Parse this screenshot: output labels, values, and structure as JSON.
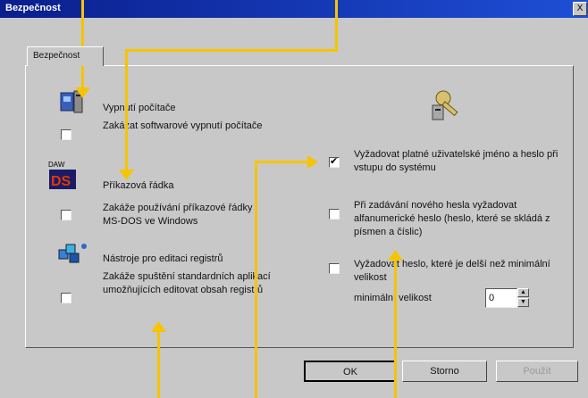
{
  "window": {
    "title": "Bezpečnost",
    "close_glyph": "X"
  },
  "tabs": [
    {
      "label": "Bezpečnost"
    }
  ],
  "left_options": [
    {
      "icon": "computer-icon",
      "title": "Vypnutí počítače",
      "description": "Zakázat softwarové vypnutí počítače",
      "checked": false
    },
    {
      "icon": "dos-icon",
      "title": "Příkazová řádka",
      "description": "Zakáže používání příkazové řádky MS-DOS ve Windows",
      "checked": false
    },
    {
      "icon": "registry-editor-icon",
      "title": "Nástroje pro editaci registrů",
      "description": "Zakáže spuštění standardních aplikací umožňujících editovat obsah registrů",
      "checked": false
    }
  ],
  "right_options": [
    {
      "text": "Vyžadovat platné uživatelské jméno a heslo při vstupu do systému",
      "checked": true
    },
    {
      "text": "Při zadávání nového hesla vyžadovat alfanumerické heslo (heslo, které se skládá z písmen a číslic)",
      "checked": false
    },
    {
      "text": "Vyžadovat heslo, které je delší než minimální velikost",
      "checked": false
    }
  ],
  "min_length": {
    "label": "minimální velikost",
    "value": "0"
  },
  "icons": {
    "keys": "keys-icon",
    "spin_up": "▲",
    "spin_down": "▼"
  },
  "buttons": {
    "ok": "OK",
    "cancel": "Storno",
    "apply": "Použít"
  },
  "colors": {
    "titlebar": "#0a1e8c",
    "arrow": "#f6c400",
    "face": "#c8c8c8"
  }
}
